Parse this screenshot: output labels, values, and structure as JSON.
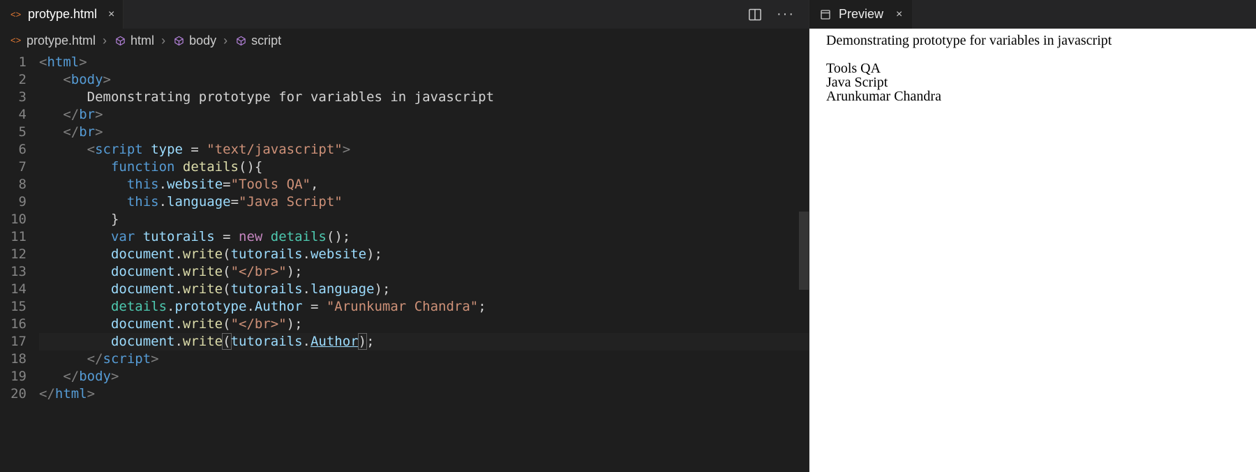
{
  "editorTab": {
    "filename": "protype.html",
    "closeGlyph": "×"
  },
  "breadcrumb": {
    "items": [
      {
        "label": "protype.html",
        "iconColor": "#e37933",
        "iconType": "file"
      },
      {
        "label": "html",
        "iconColor": "#b180d7",
        "iconType": "cube"
      },
      {
        "label": "body",
        "iconColor": "#b180d7",
        "iconType": "cube"
      },
      {
        "label": "script",
        "iconColor": "#b180d7",
        "iconType": "cube"
      }
    ],
    "sep": "›"
  },
  "code": {
    "lineCount": 20,
    "highlightLine": 17,
    "lines": [
      [
        {
          "t": "<",
          "c": "p"
        },
        {
          "t": "html",
          "c": "tag"
        },
        {
          "t": ">",
          "c": "p"
        }
      ],
      [
        {
          "t": "    ",
          "c": "txt"
        },
        {
          "t": "<",
          "c": "p"
        },
        {
          "t": "body",
          "c": "tag"
        },
        {
          "t": ">",
          "c": "p"
        }
      ],
      [
        {
          "t": "        ",
          "c": "txt"
        },
        {
          "t": "Demonstrating prototype for variables in javascript",
          "c": "txt"
        }
      ],
      [
        {
          "t": "    ",
          "c": "txt"
        },
        {
          "t": "</",
          "c": "p"
        },
        {
          "t": "br",
          "c": "tag"
        },
        {
          "t": ">",
          "c": "p"
        }
      ],
      [
        {
          "t": "    ",
          "c": "txt"
        },
        {
          "t": "</",
          "c": "p"
        },
        {
          "t": "br",
          "c": "tag"
        },
        {
          "t": ">",
          "c": "p"
        }
      ],
      [
        {
          "t": "        ",
          "c": "txt"
        },
        {
          "t": "<",
          "c": "p"
        },
        {
          "t": "script",
          "c": "tag"
        },
        {
          "t": " ",
          "c": "txt"
        },
        {
          "t": "type",
          "c": "attr"
        },
        {
          "t": " = ",
          "c": "txt"
        },
        {
          "t": "\"text/javascript\"",
          "c": "str"
        },
        {
          "t": ">",
          "c": "p"
        }
      ],
      [
        {
          "t": "            ",
          "c": "txt"
        },
        {
          "t": "function",
          "c": "kw"
        },
        {
          "t": " ",
          "c": "txt"
        },
        {
          "t": "details",
          "c": "fn"
        },
        {
          "t": "(){",
          "c": "txt"
        }
      ],
      [
        {
          "t": "              ",
          "c": "txt"
        },
        {
          "t": "this",
          "c": "kw"
        },
        {
          "t": ".",
          "c": "txt"
        },
        {
          "t": "website",
          "c": "prop"
        },
        {
          "t": "=",
          "c": "txt"
        },
        {
          "t": "\"Tools QA\"",
          "c": "str"
        },
        {
          "t": ",",
          "c": "txt"
        }
      ],
      [
        {
          "t": "              ",
          "c": "txt"
        },
        {
          "t": "this",
          "c": "kw"
        },
        {
          "t": ".",
          "c": "txt"
        },
        {
          "t": "language",
          "c": "prop"
        },
        {
          "t": "=",
          "c": "txt"
        },
        {
          "t": "\"Java Script\"",
          "c": "str"
        }
      ],
      [
        {
          "t": "            }",
          "c": "txt"
        }
      ],
      [
        {
          "t": "            ",
          "c": "txt"
        },
        {
          "t": "var",
          "c": "kw"
        },
        {
          "t": " ",
          "c": "txt"
        },
        {
          "t": "tutorails",
          "c": "var"
        },
        {
          "t": " = ",
          "c": "txt"
        },
        {
          "t": "new",
          "c": "kw2"
        },
        {
          "t": " ",
          "c": "txt"
        },
        {
          "t": "details",
          "c": "cls"
        },
        {
          "t": "();",
          "c": "txt"
        }
      ],
      [
        {
          "t": "            ",
          "c": "txt"
        },
        {
          "t": "document",
          "c": "var"
        },
        {
          "t": ".",
          "c": "txt"
        },
        {
          "t": "write",
          "c": "fn"
        },
        {
          "t": "(",
          "c": "txt"
        },
        {
          "t": "tutorails",
          "c": "var"
        },
        {
          "t": ".",
          "c": "txt"
        },
        {
          "t": "website",
          "c": "prop"
        },
        {
          "t": ");",
          "c": "txt"
        }
      ],
      [
        {
          "t": "            ",
          "c": "txt"
        },
        {
          "t": "document",
          "c": "var"
        },
        {
          "t": ".",
          "c": "txt"
        },
        {
          "t": "write",
          "c": "fn"
        },
        {
          "t": "(",
          "c": "txt"
        },
        {
          "t": "\"</br>\"",
          "c": "str"
        },
        {
          "t": ");",
          "c": "txt"
        }
      ],
      [
        {
          "t": "            ",
          "c": "txt"
        },
        {
          "t": "document",
          "c": "var"
        },
        {
          "t": ".",
          "c": "txt"
        },
        {
          "t": "write",
          "c": "fn"
        },
        {
          "t": "(",
          "c": "txt"
        },
        {
          "t": "tutorails",
          "c": "var"
        },
        {
          "t": ".",
          "c": "txt"
        },
        {
          "t": "language",
          "c": "prop"
        },
        {
          "t": ");",
          "c": "txt"
        }
      ],
      [
        {
          "t": "            ",
          "c": "txt"
        },
        {
          "t": "details",
          "c": "cls"
        },
        {
          "t": ".",
          "c": "txt"
        },
        {
          "t": "prototype",
          "c": "var"
        },
        {
          "t": ".",
          "c": "txt"
        },
        {
          "t": "Author",
          "c": "prop"
        },
        {
          "t": " = ",
          "c": "txt"
        },
        {
          "t": "\"Arunkumar Chandra\"",
          "c": "str"
        },
        {
          "t": ";",
          "c": "txt"
        }
      ],
      [
        {
          "t": "            ",
          "c": "txt"
        },
        {
          "t": "document",
          "c": "var"
        },
        {
          "t": ".",
          "c": "txt"
        },
        {
          "t": "write",
          "c": "fn"
        },
        {
          "t": "(",
          "c": "txt"
        },
        {
          "t": "\"</br>\"",
          "c": "str"
        },
        {
          "t": ");",
          "c": "txt"
        }
      ],
      [
        {
          "t": "            ",
          "c": "txt"
        },
        {
          "t": "document",
          "c": "var"
        },
        {
          "t": ".",
          "c": "txt"
        },
        {
          "t": "write",
          "c": "fn"
        },
        {
          "t": "(",
          "c": "brk"
        },
        {
          "t": "tutorails",
          "c": "var"
        },
        {
          "t": ".",
          "c": "txt"
        },
        {
          "t": "Author",
          "c": "link"
        },
        {
          "t": ")",
          "c": "brk"
        },
        {
          "t": ";",
          "c": "txt"
        }
      ],
      [
        {
          "t": "        ",
          "c": "txt"
        },
        {
          "t": "</",
          "c": "p"
        },
        {
          "t": "script",
          "c": "tag"
        },
        {
          "t": ">",
          "c": "p"
        }
      ],
      [
        {
          "t": "    ",
          "c": "txt"
        },
        {
          "t": "</",
          "c": "p"
        },
        {
          "t": "body",
          "c": "tag"
        },
        {
          "t": ">",
          "c": "p"
        }
      ],
      [
        {
          "t": "</",
          "c": "p"
        },
        {
          "t": "html",
          "c": "tag"
        },
        {
          "t": ">",
          "c": "p"
        }
      ]
    ]
  },
  "previewTab": {
    "label": "Preview",
    "closeGlyph": "×"
  },
  "previewBody": {
    "heading": "Demonstrating prototype for variables in javascript",
    "rows": [
      "Tools QA",
      "Java Script",
      "Arunkumar Chandra"
    ]
  }
}
